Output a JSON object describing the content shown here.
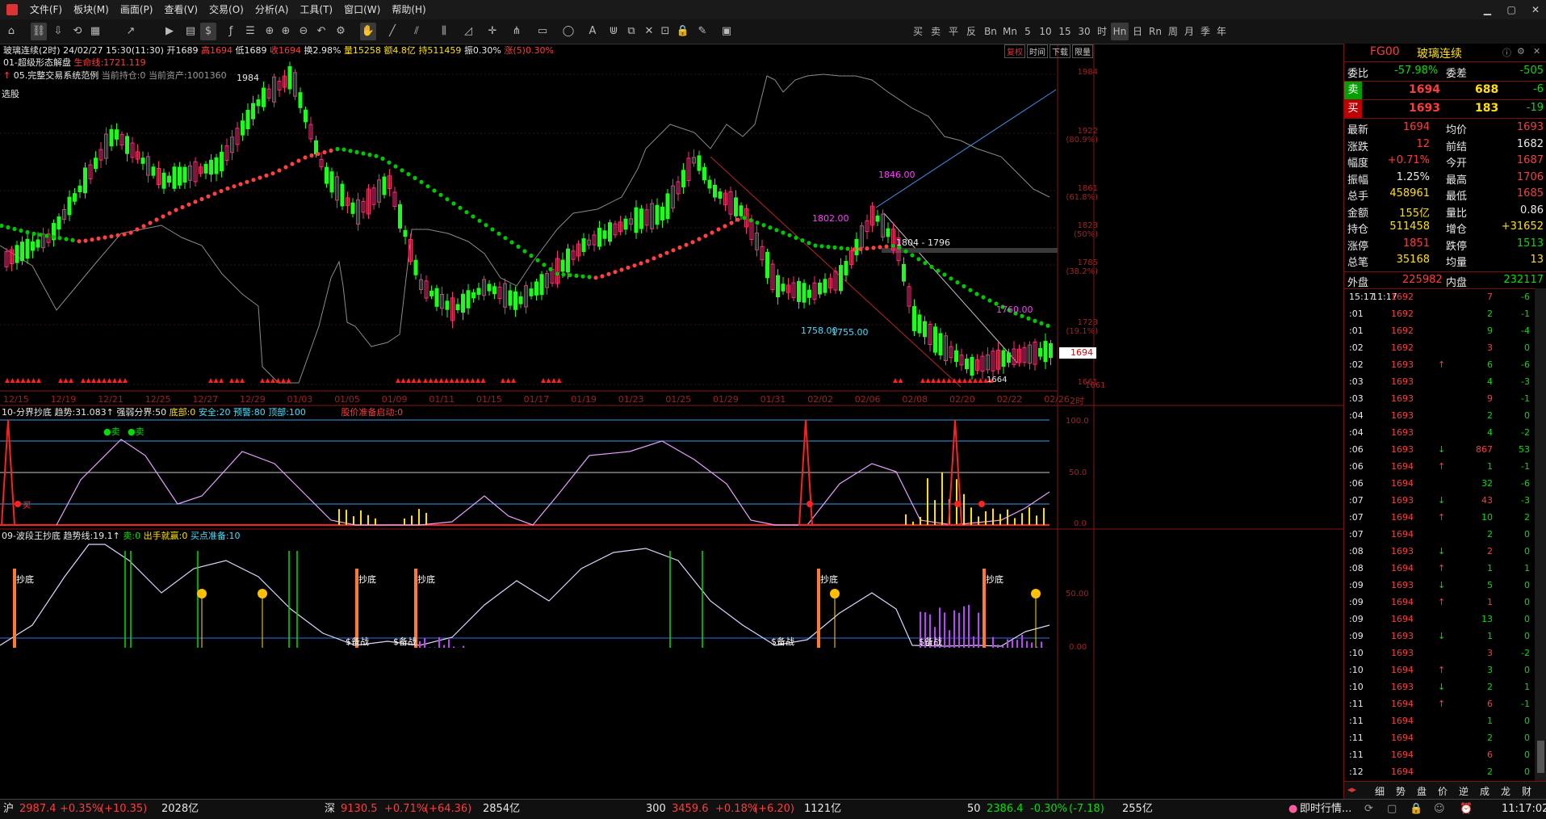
{
  "menu": [
    "文件(F)",
    "板块(M)",
    "画面(P)",
    "查看(V)",
    "交易(O)",
    "分析(A)",
    "工具(T)",
    "窗口(W)",
    "帮助(H)"
  ],
  "toolbar_right": [
    "买",
    "卖",
    "平",
    "反",
    "Bn",
    "Mn",
    "5",
    "10",
    "15",
    "30",
    "时",
    "Hn",
    "日",
    "Rn",
    "周",
    "月",
    "季",
    "年"
  ],
  "header": {
    "line1": {
      "name": "玻璃连续(2时)",
      "datetime": "24/02/27 15:30(11:30)",
      "open": "开1689",
      "high": "高1694",
      "low": "低1689",
      "close": "收1694",
      "turnover": "换2.98%",
      "volume": "量15258",
      "amount": "额4.8亿",
      "oi": "持511459",
      "amp": "振0.30%",
      "chg": "涨(5)0.30%"
    },
    "line2": {
      "name": "01-超级形态解盘",
      "life": "生命线:1721.119"
    },
    "line3": {
      "name": "05.完整交易系统范例",
      "pos": "当前持仓:0",
      "asset": "当前资产:1001360"
    },
    "select_label": "选股",
    "top_right_buttons": [
      "复权",
      "时间",
      "下载",
      "限量"
    ]
  },
  "price_axis": [
    {
      "v": "1984",
      "pct": ""
    },
    {
      "v": "1922",
      "pct": "(80.9%)"
    },
    {
      "v": "1861",
      "pct": "(61.8%)"
    },
    {
      "v": "1823",
      "pct": "(50%)"
    },
    {
      "v": "1785",
      "pct": "(38.2%)"
    },
    {
      "v": "1723",
      "pct": "(19.1%)"
    },
    {
      "v": "1661",
      "pct": ""
    }
  ],
  "current_price_tag": "1694",
  "annotations": {
    "high_label": "1984",
    "p1846": "1846.00",
    "p1802": "1802.00",
    "p1758": "1758.00",
    "p1755": "1755.00",
    "p1760": "1760.00",
    "range": "1804 - 1796",
    "p1661": "1661",
    "p1664": "1664"
  },
  "dates": [
    "12/15",
    "12/19",
    "12/21",
    "12/25",
    "12/27",
    "12/29",
    "01/03",
    "01/05",
    "01/09",
    "01/11",
    "01/15",
    "01/17",
    "01/19",
    "01/23",
    "01/25",
    "01/29",
    "01/31",
    "02/02",
    "02/06",
    "02/08",
    "02/20",
    "02/22",
    "02/26"
  ],
  "time_unit": "2时",
  "indicator1": {
    "title": "10-分界抄底",
    "trend": "趋势:31.083",
    "strong": "强弱分界:50",
    "bottom": "底部:0",
    "safe": "安全:20",
    "warn": "预警:80",
    "top": "顶部:100",
    "start": "股价准备启动:0",
    "axis": [
      "100.0",
      "50.0",
      "0.0"
    ],
    "sell_labels": [
      "卖",
      "卖"
    ],
    "buy_label": "买"
  },
  "indicator2": {
    "title": "09-波段王抄底",
    "trend": "趋势线:19.1",
    "sell": "卖:0",
    "buyin": "出手就赢:0",
    "ready": "买点准备:10",
    "axis": [
      "50.00",
      "0.00"
    ],
    "chaodi": "抄底",
    "bejian": "$备战"
  },
  "quote": {
    "code": "FG00",
    "name": "玻璃连续",
    "weibi_label": "委比",
    "weibi": "-57.98%",
    "weicha_label": "委差",
    "weicha": "-505",
    "sell_label": "卖",
    "sell_price": "1694",
    "sell_vol": "688",
    "sell_chg": "-6",
    "buy_label": "买",
    "buy_price": "1693",
    "buy_vol": "183",
    "buy_chg": "-19",
    "rows": [
      [
        "最新",
        "1694",
        "均价",
        "1693"
      ],
      [
        "涨跌",
        "12",
        "前结",
        "1682"
      ],
      [
        "幅度",
        "+0.71%",
        "今开",
        "1687"
      ],
      [
        "振幅",
        "1.25%",
        "最高",
        "1706"
      ],
      [
        "总手",
        "458961",
        "最低",
        "1685"
      ],
      [
        "金额",
        "155亿",
        "量比",
        "0.86"
      ],
      [
        "持仓",
        "511458",
        "增仓",
        "+31652"
      ],
      [
        "涨停",
        "1851",
        "跌停",
        "1513"
      ],
      [
        "总笔",
        "35168",
        "均量",
        "13"
      ]
    ],
    "outer_label": "外盘",
    "outer": "225982",
    "inner_label": "内盘",
    "inner": "232117"
  },
  "ticks": [
    [
      "15:17",
      "11:17",
      "1692",
      "",
      "7",
      "-6"
    ],
    [
      ":01",
      "",
      "1692",
      "",
      "2",
      "-1"
    ],
    [
      ":01",
      "",
      "1692",
      "",
      "9",
      "-4"
    ],
    [
      ":02",
      "",
      "1692",
      "",
      "3",
      "0"
    ],
    [
      ":02",
      "",
      "1693",
      "↑",
      "6",
      "-6"
    ],
    [
      ":03",
      "",
      "1693",
      "",
      "4",
      "-3"
    ],
    [
      ":03",
      "",
      "1693",
      "",
      "9",
      "-1"
    ],
    [
      ":04",
      "",
      "1693",
      "",
      "2",
      "0"
    ],
    [
      ":04",
      "",
      "1693",
      "",
      "4",
      "-2"
    ],
    [
      ":06",
      "",
      "1693",
      "↓",
      "867",
      "53"
    ],
    [
      ":06",
      "",
      "1694",
      "↑",
      "1",
      "-1"
    ],
    [
      ":06",
      "",
      "1694",
      "",
      "32",
      "-6"
    ],
    [
      ":07",
      "",
      "1693",
      "↓",
      "43",
      "-3"
    ],
    [
      ":07",
      "",
      "1694",
      "↑",
      "10",
      "2"
    ],
    [
      ":07",
      "",
      "1694",
      "",
      "2",
      "0"
    ],
    [
      ":08",
      "",
      "1693",
      "↓",
      "2",
      "0"
    ],
    [
      ":08",
      "",
      "1694",
      "↑",
      "1",
      "1"
    ],
    [
      ":09",
      "",
      "1693",
      "↓",
      "5",
      "0"
    ],
    [
      ":09",
      "",
      "1694",
      "↑",
      "1",
      "0"
    ],
    [
      ":09",
      "",
      "1694",
      "",
      "13",
      "0"
    ],
    [
      ":09",
      "",
      "1693",
      "↓",
      "1",
      "0"
    ],
    [
      ":10",
      "",
      "1693",
      "",
      "3",
      "-2"
    ],
    [
      ":10",
      "",
      "1694",
      "↑",
      "3",
      "0"
    ],
    [
      ":10",
      "",
      "1693",
      "↓",
      "2",
      "1"
    ],
    [
      ":11",
      "",
      "1694",
      "↑",
      "6",
      "-1"
    ],
    [
      ":11",
      "",
      "1694",
      "",
      "1",
      "0"
    ],
    [
      ":11",
      "",
      "1694",
      "",
      "2",
      "0"
    ],
    [
      ":11",
      "",
      "1694",
      "",
      "6",
      "0"
    ],
    [
      ":12",
      "",
      "1694",
      "",
      "2",
      "0"
    ]
  ],
  "bottom_tabs": [
    "细",
    "势",
    "盘",
    "价",
    "逆",
    "成",
    "龙",
    "财"
  ],
  "status": {
    "sh_label": "沪",
    "sh_val": "2987.4",
    "sh_chg": "+0.35%",
    "sh_pt": "(+10.35)",
    "sh_amt": "2028亿",
    "sz_label": "深",
    "sz_val": "9130.5",
    "sz_chg": "+0.71%",
    "sz_pt": "(+64.36)",
    "sz_amt": "2854亿",
    "c300_label": "300",
    "c300_val": "3459.6",
    "c300_chg": "+0.18%",
    "c300_pt": "(+6.20)",
    "c300_amt": "1121亿",
    "c50_label": "50",
    "c50_val": "2386.4",
    "c50_chg": "-0.30%",
    "c50_pt": "(-7.18)",
    "c50_amt": "255亿",
    "news": "即时行情...",
    "clock": "11:17:02"
  },
  "colors": {
    "up": "#ff3b3b",
    "down": "#00e000",
    "ma_up": "#ff4040",
    "ma_dn": "#00c800",
    "bg": "#000000",
    "accent": "#ffe000"
  }
}
